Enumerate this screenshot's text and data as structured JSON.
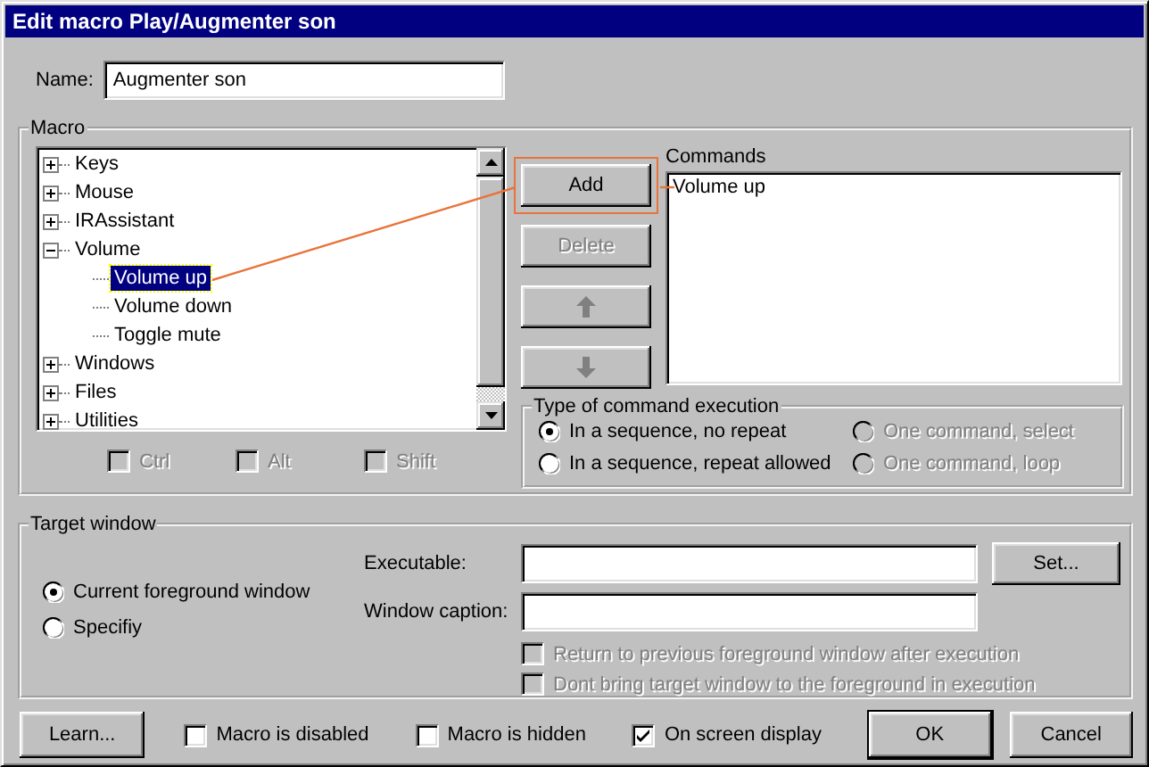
{
  "window": {
    "title": "Edit macro Play/Augmenter son"
  },
  "name": {
    "label": "Name:",
    "value": "Augmenter son"
  },
  "macro": {
    "title": "Macro",
    "tree": [
      {
        "label": "Keys",
        "expanded": false,
        "selected": false
      },
      {
        "label": "Mouse",
        "expanded": false,
        "selected": false
      },
      {
        "label": "IRAssistant",
        "expanded": false,
        "selected": false
      },
      {
        "label": "Volume",
        "expanded": true,
        "selected": false,
        "children": [
          {
            "label": "Volume up",
            "selected": true
          },
          {
            "label": "Volume down",
            "selected": false
          },
          {
            "label": "Toggle mute",
            "selected": false
          }
        ]
      },
      {
        "label": "Windows",
        "expanded": false,
        "selected": false
      },
      {
        "label": "Files",
        "expanded": false,
        "selected": false
      },
      {
        "label": "Utilities",
        "expanded": false,
        "selected": false
      }
    ],
    "modifiers": [
      {
        "label": "Ctrl",
        "checked": false,
        "disabled": true
      },
      {
        "label": "Alt",
        "checked": false,
        "disabled": true
      },
      {
        "label": "Shift",
        "checked": false,
        "disabled": true
      }
    ],
    "buttons": [
      {
        "kind": "text",
        "label": "Add",
        "disabled": false,
        "highlighted": true
      },
      {
        "kind": "text",
        "label": "Delete",
        "disabled": true,
        "highlighted": false
      },
      {
        "kind": "up",
        "disabled": true,
        "highlighted": false
      },
      {
        "kind": "down",
        "disabled": true,
        "highlighted": false
      }
    ],
    "commands": {
      "label": "Commands",
      "items": [
        "Volume up"
      ]
    },
    "execution": {
      "title": "Type of command execution",
      "options": [
        {
          "label": "In a sequence, no repeat",
          "selected": true,
          "disabled": false
        },
        {
          "label": "One command, select",
          "selected": false,
          "disabled": true
        },
        {
          "label": "In a sequence, repeat allowed",
          "selected": false,
          "disabled": false
        },
        {
          "label": "One command, loop",
          "selected": false,
          "disabled": true
        }
      ]
    }
  },
  "target": {
    "title": "Target window",
    "modes": [
      {
        "label": "Current foreground window",
        "selected": true
      },
      {
        "label": "Specifiy",
        "selected": false
      }
    ],
    "executable_label": "Executable:",
    "caption_label": "Window caption:",
    "set_button": "Set...",
    "options": [
      {
        "label": "Return to previous foreground window after execution",
        "checked": false,
        "disabled": true
      },
      {
        "label": "Dont bring target window to the foreground in execution",
        "checked": false,
        "disabled": true
      }
    ]
  },
  "footer": {
    "learn": "Learn...",
    "checks": [
      {
        "label": "Macro is disabled",
        "checked": false
      },
      {
        "label": "Macro is hidden",
        "checked": false
      },
      {
        "label": "On screen display",
        "checked": true
      }
    ],
    "ok": "OK",
    "cancel": "Cancel"
  }
}
